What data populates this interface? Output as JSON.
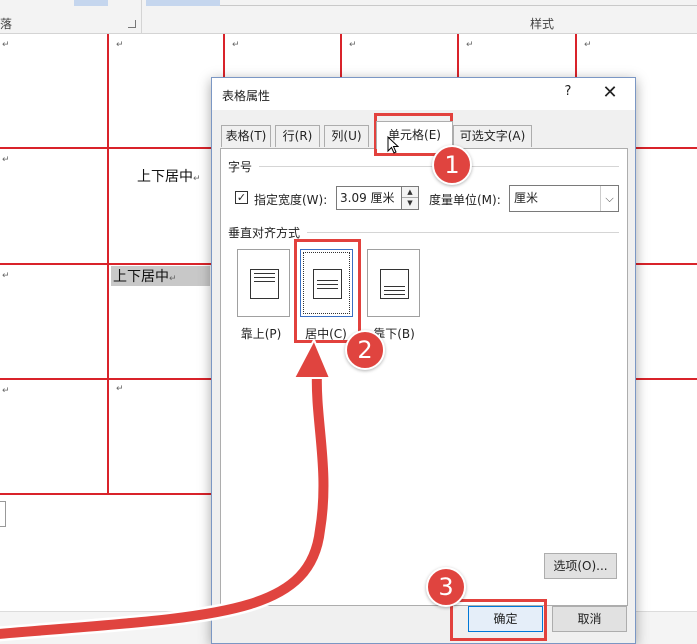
{
  "ribbon": {
    "paragraph_group_label": "落",
    "styles_group_label": "样式"
  },
  "document": {
    "cell_mark": "↵",
    "cell_text_centered": "上下居中",
    "cell_text_top": "上下居中"
  },
  "dialog": {
    "title": "表格属性",
    "help_label": "?",
    "close_label": "✕",
    "tabs": [
      {
        "label": "表格(T)",
        "active": false
      },
      {
        "label": "行(R)",
        "active": false
      },
      {
        "label": "列(U)",
        "active": false
      },
      {
        "label": "单元格(E)",
        "active": true
      },
      {
        "label": "可选文字(A)",
        "active": false
      }
    ],
    "size_section": "字号",
    "preferred_width": {
      "checked": true,
      "check_glyph": "✓",
      "label": "指定宽度(W):",
      "value": "3.09 厘米"
    },
    "measure_unit": {
      "label": "度量单位(M):",
      "value": "厘米"
    },
    "vertical_align_section": "垂直对齐方式",
    "align_options": [
      {
        "label": "靠上(P)",
        "position": "top",
        "selected": false
      },
      {
        "label": "居中(C)",
        "position": "center",
        "selected": true
      },
      {
        "label": "靠下(B)",
        "position": "bottom",
        "selected": false
      }
    ],
    "options_button": "选项(O)...",
    "ok_button": "确定",
    "cancel_button": "取消"
  },
  "annotations": {
    "step_1": "1",
    "step_2": "2",
    "step_3": "3",
    "highlight_color": "#e2413d"
  },
  "icons": {
    "spin_up": "▲",
    "spin_down": "▼",
    "dropdown": "⌵"
  }
}
